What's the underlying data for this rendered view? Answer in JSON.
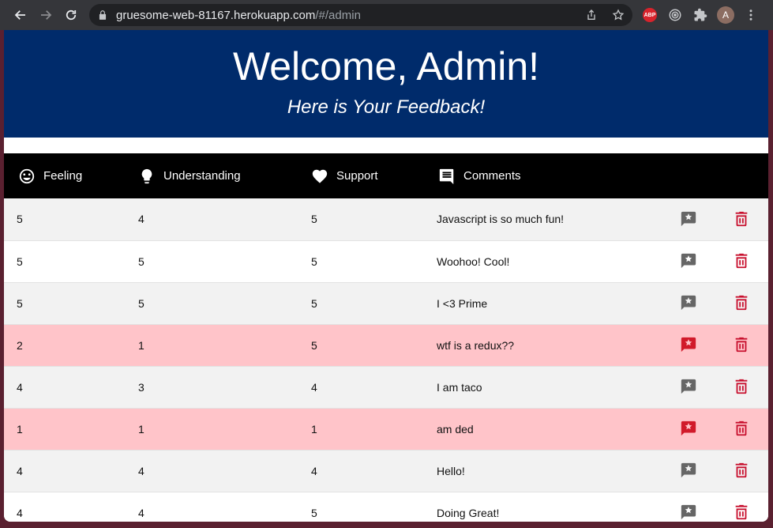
{
  "browser": {
    "url_host": "gruesome-web-81167.herokuapp.com",
    "url_path": "/#/admin",
    "extensions": [
      "adblock-plus-icon",
      "target-icon",
      "puzzle-icon"
    ],
    "abp_label": "ABP",
    "avatar_letter": "A"
  },
  "page": {
    "title": "Welcome, Admin!",
    "subtitle": "Here is Your Feedback!"
  },
  "table": {
    "headers": {
      "feeling": "Feeling",
      "understanding": "Understanding",
      "support": "Support",
      "comments": "Comments"
    },
    "rows": [
      {
        "feeling": "5",
        "understanding": "4",
        "support": "5",
        "comments": "Javascript is so much fun!",
        "flagged": false
      },
      {
        "feeling": "5",
        "understanding": "5",
        "support": "5",
        "comments": "Woohoo! Cool!",
        "flagged": false
      },
      {
        "feeling": "5",
        "understanding": "5",
        "support": "5",
        "comments": "I <3 Prime",
        "flagged": false
      },
      {
        "feeling": "2",
        "understanding": "1",
        "support": "5",
        "comments": "wtf is a redux??",
        "flagged": true
      },
      {
        "feeling": "4",
        "understanding": "3",
        "support": "4",
        "comments": "I am taco",
        "flagged": false
      },
      {
        "feeling": "1",
        "understanding": "1",
        "support": "1",
        "comments": "am ded",
        "flagged": true
      },
      {
        "feeling": "4",
        "understanding": "4",
        "support": "4",
        "comments": "Hello!",
        "flagged": false
      },
      {
        "feeling": "4",
        "understanding": "4",
        "support": "5",
        "comments": "Doing Great!",
        "flagged": false
      }
    ]
  },
  "colors": {
    "banner": "#002b6b",
    "header_row": "#000000",
    "flagged_row": "#ffc4c9",
    "flag_active": "#d11a2a",
    "trash": "#c8102e"
  }
}
